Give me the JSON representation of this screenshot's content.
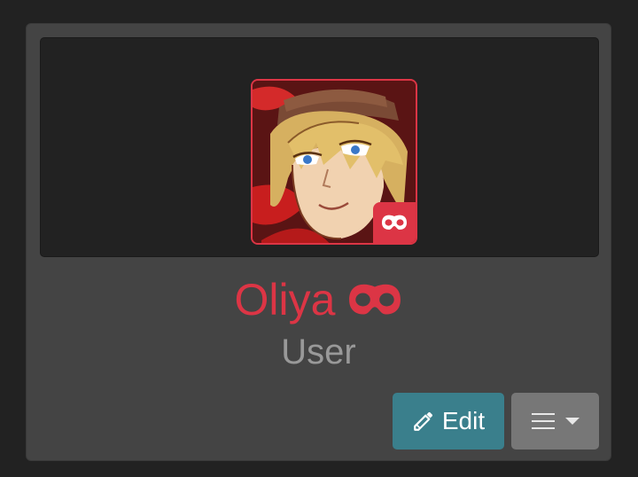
{
  "profile": {
    "name": "Oliya",
    "role": "User",
    "name_icon": "domino-mask-icon",
    "avatar_badge_icon": "domino-mask-icon"
  },
  "actions": {
    "edit_label": "Edit",
    "edit_icon": "pencil-icon",
    "menu_icon": "hamburger-icon",
    "menu_caret_icon": "caret-down-icon"
  },
  "colors": {
    "page_bg": "#222222",
    "card_bg": "#444444",
    "banner_bg": "#222222",
    "accent_red": "#dc3545",
    "role_text": "#999999",
    "edit_button_bg": "#3a7f8c",
    "menu_button_bg": "#777777"
  }
}
